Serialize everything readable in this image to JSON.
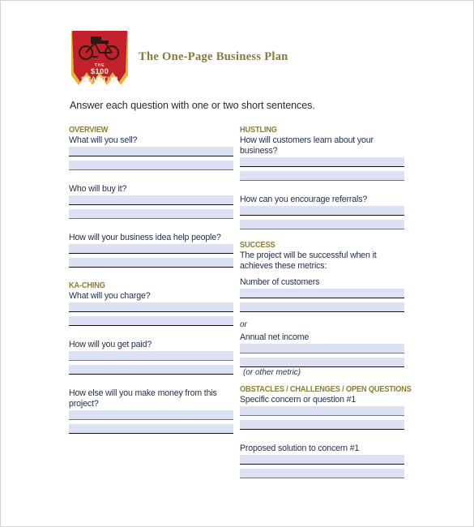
{
  "document": {
    "title": "The One-Page Business Plan",
    "intro": "Answer each question with one or two short sentences.",
    "logo": {
      "icon": "bicycle-icon",
      "line1": "THE",
      "line2": "$100",
      "line3": "STARTUP",
      "banner_color": "#c2202a",
      "banner_shadow_color": "#e8b33a",
      "text_color": "#f2e9c9"
    },
    "colors": {
      "section_heading": "#8a7e33",
      "question_text": "#23304a",
      "field_fill": "#dde1f4",
      "field_border": "#12141c",
      "title": "#857b37",
      "page_border": "#d2d2d2"
    }
  },
  "left_column": {
    "sections": [
      {
        "heading": "OVERVIEW",
        "questions": [
          {
            "label": "What will you sell?",
            "fields": 2
          },
          {
            "label": "Who will buy it?",
            "fields": 2
          },
          {
            "label": "How will your business idea help people?",
            "fields": 2
          }
        ]
      },
      {
        "heading": "KA-CHING",
        "questions": [
          {
            "label": "What will you charge?",
            "fields": 2
          },
          {
            "label": "How will you get paid?",
            "fields": 2
          },
          {
            "label": "How else will you make money from this project?",
            "fields": 2
          }
        ]
      }
    ]
  },
  "right_column": {
    "sections": [
      {
        "heading": "HUSTLING",
        "questions": [
          {
            "label": "How will customers learn about your business?",
            "fields": 2
          },
          {
            "label": "How can you encourage referrals?",
            "fields": 2
          }
        ]
      },
      {
        "heading": "SUCCESS",
        "intro": "The project will be successful when it achieves these metrics:",
        "metric_one_label": "Number of customers",
        "separator": "or",
        "metric_two_label": "Annual net income",
        "footnote": "(or other metric)"
      },
      {
        "heading": "OBSTACLES / CHALLENGES / OPEN QUESTIONS",
        "questions": [
          {
            "label": "Specific concern or question #1",
            "fields": 2
          },
          {
            "label": "Proposed solution to concern #1",
            "fields": 2
          }
        ]
      }
    ]
  }
}
